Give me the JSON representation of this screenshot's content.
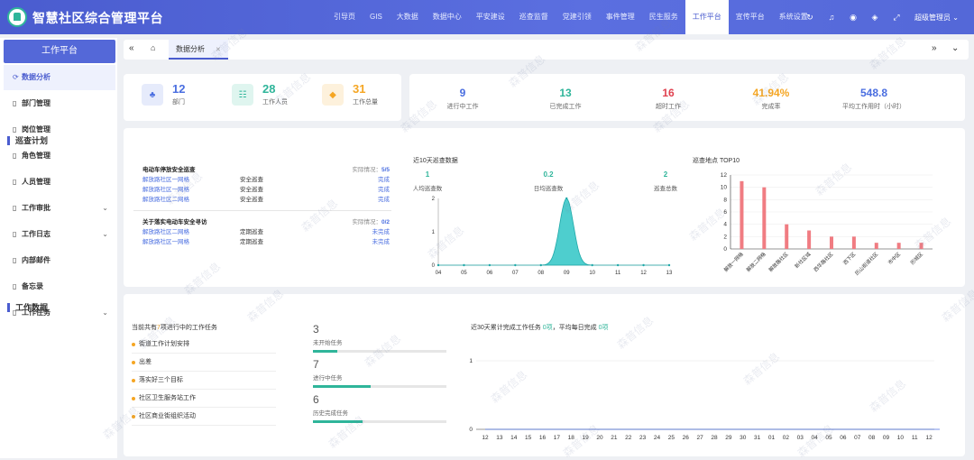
{
  "app_title": "智慧社区综合管理平台",
  "nav": [
    "引导页",
    "GIS",
    "大数据",
    "数据中心",
    "平安建设",
    "巡查监督",
    "党建引领",
    "事件管理",
    "民生服务",
    "工作平台",
    "宣传平台",
    "系统设置"
  ],
  "nav_active": 9,
  "top_icons": [
    "refresh-icon",
    "bell-icon",
    "notification-icon",
    "tag-icon",
    "fullscreen-icon"
  ],
  "user_label": "超级管理员",
  "sidebar": {
    "title": "工作平台",
    "items": [
      {
        "label": "数据分析",
        "icon": "chart-icon",
        "active": true,
        "expand": false
      },
      {
        "label": "部门管理",
        "icon": "doc-icon",
        "active": false,
        "expand": false
      },
      {
        "label": "岗位管理",
        "icon": "doc-icon",
        "active": false,
        "expand": false
      },
      {
        "label": "角色管理",
        "icon": "doc-icon",
        "active": false,
        "expand": false
      },
      {
        "label": "人员管理",
        "icon": "doc-icon",
        "active": false,
        "expand": false
      },
      {
        "label": "工作审批",
        "icon": "doc-icon",
        "active": false,
        "expand": true
      },
      {
        "label": "工作日志",
        "icon": "doc-icon",
        "active": false,
        "expand": true
      },
      {
        "label": "内部邮件",
        "icon": "doc-icon",
        "active": false,
        "expand": false
      },
      {
        "label": "备忘录",
        "icon": "doc-icon",
        "active": false,
        "expand": false
      },
      {
        "label": "工作任务",
        "icon": "doc-icon",
        "active": false,
        "expand": true
      }
    ]
  },
  "tabs": {
    "home_icon": "home-icon",
    "active_tab": "数据分析"
  },
  "stats": [
    {
      "value": "12",
      "label": "部门",
      "color": "#4a6ee0",
      "bg": "#e6ebfb",
      "icon": "org-icon"
    },
    {
      "value": "28",
      "label": "工作人员",
      "color": "#2fb59a",
      "bg": "#dff5ef",
      "icon": "people-icon"
    },
    {
      "value": "31",
      "label": "工作总量",
      "color": "#f5a623",
      "bg": "#fdf1dc",
      "icon": "box-icon"
    }
  ],
  "kpis": [
    {
      "value": "9",
      "label": "进行中工作",
      "color": "#4a6ee0"
    },
    {
      "value": "13",
      "label": "已完成工作",
      "color": "#2fb59a"
    },
    {
      "value": "16",
      "label": "超时工作",
      "color": "#e0414f"
    },
    {
      "value": "41.94%",
      "label": "完成率",
      "color": "#f5a623"
    },
    {
      "value": "548.8",
      "label": "平均工作用时（小时）",
      "color": "#4a6ee0"
    }
  ],
  "patrol": {
    "section_title": "巡查计划",
    "plans": [
      {
        "title": "电动车停放安全巡查",
        "progress_label": "实际情况：",
        "progress": "5/5",
        "rows": [
          [
            "解放路社区一网格",
            "安全巡查",
            "完成"
          ],
          [
            "解放路社区一网格",
            "安全巡查",
            "完成"
          ],
          [
            "解放路社区二网格",
            "安全巡查",
            "完成"
          ]
        ]
      },
      {
        "title": "关于落实电动车安全寻访",
        "progress_label": "实际情况：",
        "progress": "0/2",
        "rows": [
          [
            "解放路社区二网格",
            "定期巡查",
            "未完成"
          ],
          [
            "解放路社区一网格",
            "定期巡查",
            "未完成"
          ]
        ]
      }
    ]
  },
  "ten_day": {
    "title": "近10天巡查数据",
    "stats": [
      {
        "value": "1",
        "label": "人均巡查数"
      },
      {
        "value": "0.2",
        "label": "日均巡查数"
      },
      {
        "value": "2",
        "label": "巡查总数"
      }
    ]
  },
  "top10_title": "巡查地点 TOP10",
  "work": {
    "section_title": "工作数据",
    "task_title_pre": "当前共有",
    "task_count": "7",
    "task_title_post": "项进行中的工作任务",
    "tasks": [
      "街道工作计划安排",
      "出差",
      "落实好三个目标",
      "社区卫生服务站工作",
      "社区商业街组织活动"
    ],
    "progress": [
      {
        "value": "3",
        "label": "未开始任务",
        "fraction": 0.18
      },
      {
        "value": "7",
        "label": "进行中任务",
        "fraction": 0.43
      },
      {
        "value": "6",
        "label": "历史完成任务",
        "fraction": 0.37
      }
    ],
    "month_title_pre": "近30天累计完成工作任务 ",
    "month_total": "0项",
    "month_mid": "，平均每日完成 ",
    "month_avg": "0项"
  },
  "watermark": "森普信息",
  "chart_data": [
    {
      "type": "area",
      "title": "近10天巡查数据",
      "x": [
        "04",
        "05",
        "06",
        "07",
        "08",
        "09",
        "10",
        "11",
        "12",
        "13"
      ],
      "y": [
        0,
        0,
        0,
        0,
        0,
        2,
        0,
        0,
        0,
        0
      ],
      "ylim": [
        0,
        2
      ],
      "yticks": [
        0,
        1,
        2
      ],
      "color": "#2fc6c6",
      "grid": false
    },
    {
      "type": "bar",
      "title": "巡查地点 TOP10",
      "categories": [
        "解放一网格",
        "解放二网格",
        "解放路社区",
        "新社区域",
        "西华路社区",
        "西下区",
        "历山街道社区",
        "市中区",
        "历城区"
      ],
      "values": [
        11,
        10,
        4,
        3,
        2,
        2,
        1,
        1,
        1
      ],
      "ylim": [
        0,
        12
      ],
      "yticks": [
        0,
        2,
        4,
        6,
        8,
        10,
        12
      ],
      "color": "#f07c82",
      "grid": true
    },
    {
      "type": "line",
      "title": "近30天累计完成工作任务",
      "x": [
        "12",
        "13",
        "14",
        "15",
        "16",
        "17",
        "18",
        "19",
        "20",
        "21",
        "22",
        "23",
        "24",
        "25",
        "26",
        "27",
        "28",
        "29",
        "30",
        "31",
        "01",
        "02",
        "03",
        "04",
        "05",
        "06",
        "07",
        "08",
        "09",
        "10",
        "11",
        "12",
        "13"
      ],
      "y": [
        0,
        0,
        0,
        0,
        0,
        0,
        0,
        0,
        0,
        0,
        0,
        0,
        0,
        0,
        0,
        0,
        0,
        0,
        0,
        0,
        0,
        0,
        0,
        0,
        0,
        0,
        0,
        0,
        0,
        0,
        0,
        0,
        0
      ],
      "ylim": [
        0,
        1
      ],
      "yticks": [
        0,
        1
      ],
      "grid": true
    }
  ]
}
